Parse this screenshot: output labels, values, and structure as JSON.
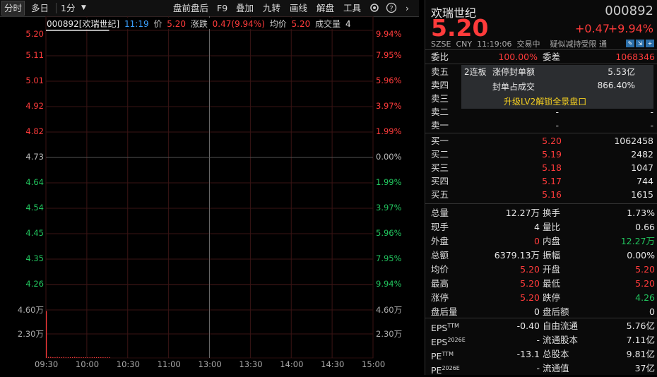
{
  "toolbar": {
    "tabs": [
      "分时",
      "多日",
      "1分"
    ],
    "actions": [
      "盘前盘后",
      "F9",
      "叠加",
      "九转",
      "画线",
      "解盘",
      "工具"
    ],
    "settings_icon": "gear-icon",
    "help_icon": "help-icon",
    "collapse_icon": "chevron-right-icon"
  },
  "chart_header": {
    "code_name": "000892[欢瑞世纪]",
    "time": "11:19",
    "price_label": "价",
    "price": "5.20",
    "change_label": "涨跌",
    "change": "0.47(9.94%)",
    "avg_label": "均价",
    "avg": "5.20",
    "volume_label": "成交量",
    "volume": "4"
  },
  "chart_data": {
    "type": "line",
    "price_axis": [
      "5.20",
      "5.11",
      "5.01",
      "4.92",
      "4.82",
      "4.73",
      "4.64",
      "4.54",
      "4.45",
      "4.35",
      "4.26"
    ],
    "pct_axis": [
      "9.94%",
      "7.95%",
      "5.96%",
      "3.97%",
      "1.99%",
      "0.00%",
      "1.99%",
      "3.97%",
      "5.96%",
      "7.95%",
      "9.94%"
    ],
    "volume_axis_left": [
      "4.60万",
      "2.30万"
    ],
    "volume_axis_right": [
      "4.60万",
      "2.30万"
    ],
    "x_ticks": [
      "09:30",
      "10:00",
      "10:30",
      "11:00",
      "13:00",
      "13:30",
      "14:00",
      "14:30",
      "15:00"
    ],
    "prev_close": 4.73,
    "ylim": [
      4.26,
      5.2
    ],
    "series": [
      {
        "values": [
          5.2,
          5.2,
          5.2,
          5.2,
          5.2,
          5.2,
          5.2,
          5.2,
          5.2,
          5.2,
          5.2,
          5.2,
          5.2,
          5.2,
          5.2,
          5.2,
          5.2,
          5.2,
          5.2,
          5.2,
          5.2,
          5.2,
          5.2,
          5.2,
          5.2,
          5.2,
          5.2,
          5.2,
          5.2,
          5.2
        ]
      }
    ],
    "volume_bars": [
      4.5,
      0.1,
      0.1,
      0.05,
      0.05,
      0.1,
      0.05,
      0.05,
      0.1,
      0.05,
      0.05,
      0.05,
      0.05,
      0.1,
      0.05,
      0.05,
      0.05,
      0.05,
      0.05,
      0.05,
      0.05,
      0.05,
      0.05,
      0.05,
      0.05,
      0.05,
      0.05,
      0.05,
      0.05,
      0.05
    ],
    "volume_max": 4.6
  },
  "quote": {
    "name": "欢瑞世纪",
    "code": "000892",
    "price": "5.20",
    "change": "+0.47",
    "change_pct": "+9.94%",
    "exchange": "SZSE",
    "currency": "CNY",
    "time": "11:19:06",
    "status": "交易中",
    "note": "疑似减持受限",
    "tong_label": "通"
  },
  "commission": {
    "ratio_label": "委比",
    "ratio": "100.00%",
    "diff_label": "委差",
    "diff": "1068346"
  },
  "sell": [
    {
      "label": "卖五",
      "price": "-",
      "vol": "-"
    },
    {
      "label": "卖四",
      "price": "-",
      "vol": "-"
    },
    {
      "label": "卖三",
      "price": "-",
      "vol": "-"
    },
    {
      "label": "卖二",
      "price": "-",
      "vol": "-"
    },
    {
      "label": "卖一",
      "price": "-",
      "vol": "-"
    }
  ],
  "seal": {
    "streak": "2连板",
    "amount_label": "涨停封单额",
    "amount": "5.53亿",
    "ratio_label": "封单占成交",
    "ratio": "866.40%",
    "upgrade": "升级LV2解锁全景盘口"
  },
  "buy": [
    {
      "label": "买一",
      "price": "5.20",
      "vol": "1062458"
    },
    {
      "label": "买二",
      "price": "5.19",
      "vol": "2482"
    },
    {
      "label": "买三",
      "price": "5.18",
      "vol": "1047"
    },
    {
      "label": "买四",
      "price": "5.17",
      "vol": "744"
    },
    {
      "label": "买五",
      "price": "5.16",
      "vol": "1615"
    }
  ],
  "stats": [
    {
      "l1": "总量",
      "v1": "12.27万",
      "c1": "white",
      "l2": "换手",
      "v2": "1.73%",
      "c2": "white"
    },
    {
      "l1": "现手",
      "v1": "4",
      "c1": "white",
      "l2": "量比",
      "v2": "0.66",
      "c2": "white"
    },
    {
      "l1": "外盘",
      "v1": "0",
      "c1": "red",
      "l2": "内盘",
      "v2": "12.27万",
      "c2": "green"
    },
    {
      "l1": "总额",
      "v1": "6379.13万",
      "c1": "white",
      "l2": "振幅",
      "v2": "0.00%",
      "c2": "white"
    },
    {
      "l1": "均价",
      "v1": "5.20",
      "c1": "red",
      "l2": "开盘",
      "v2": "5.20",
      "c2": "red"
    },
    {
      "l1": "最高",
      "v1": "5.20",
      "c1": "red",
      "l2": "最低",
      "v2": "5.20",
      "c2": "red"
    },
    {
      "l1": "涨停",
      "v1": "5.20",
      "c1": "red",
      "l2": "跌停",
      "v2": "4.26",
      "c2": "green"
    },
    {
      "l1": "盘后量",
      "v1": "0",
      "c1": "white",
      "l2": "盘后额",
      "v2": "0",
      "c2": "white"
    }
  ],
  "fundamentals": [
    {
      "l1": "EPS",
      "s1": "TTM",
      "v1": "-0.40",
      "l2": "自由流通",
      "v2": "5.76亿"
    },
    {
      "l1": "EPS",
      "s1": "2026E",
      "v1": "-",
      "l2": "流通股本",
      "v2": "7.11亿"
    },
    {
      "l1": "PE",
      "s1": "TTM",
      "v1": "-13.1",
      "l2": "总股本",
      "v2": "9.81亿"
    },
    {
      "l1": "PE",
      "s1": "2026E",
      "v1": "-",
      "l2": "流通值",
      "v2": "37亿"
    }
  ],
  "colors": {
    "up": "#ff3b3b",
    "down": "#22c55e",
    "bg": "#000000",
    "grid": "#3a1414"
  }
}
